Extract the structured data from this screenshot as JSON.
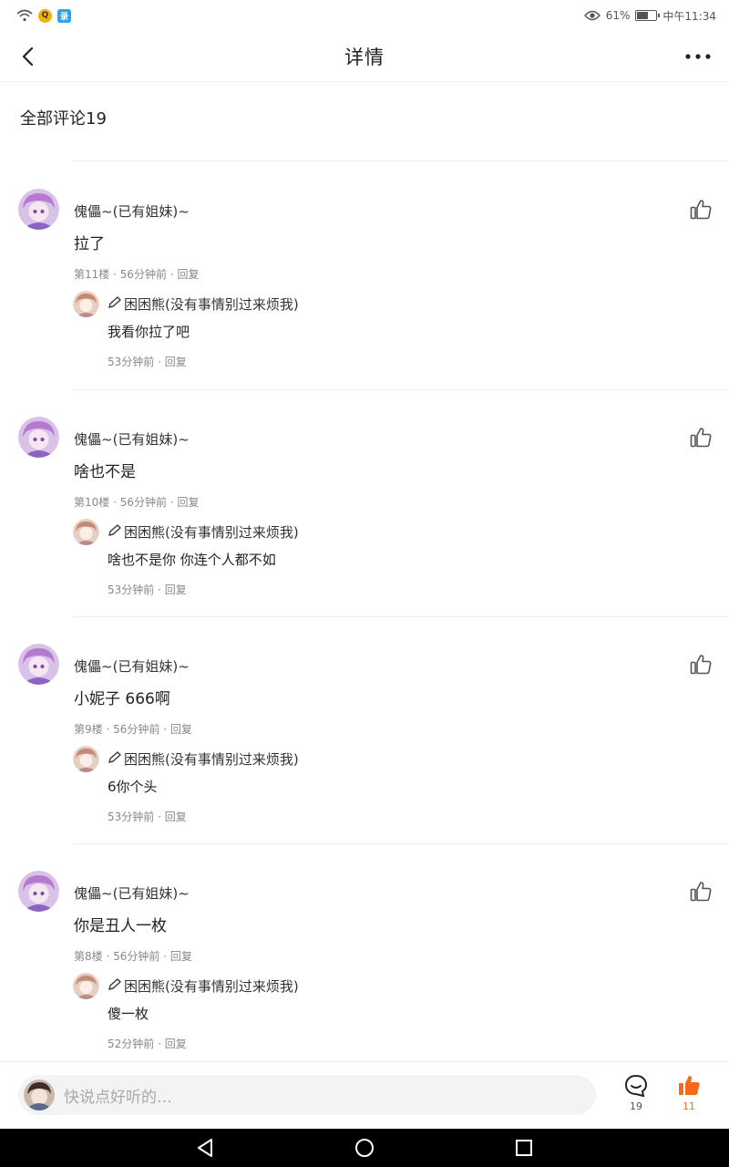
{
  "status_bar": {
    "left_icons": [
      "wifi-icon",
      "app-yellow-icon",
      "app-blue-icon"
    ],
    "yellow_badge": "Q",
    "blue_badge": "录",
    "battery_percent": "61%",
    "battery_level": 0.61,
    "time": "中午11:34"
  },
  "header": {
    "title": "详情"
  },
  "comments_header": "全部评论19",
  "comments": [
    {
      "author": "傀儡~(已有姐妹)~",
      "text": "拉了",
      "floor": "第11楼",
      "time": "56分钟前",
      "reply_label": "回复",
      "reply": {
        "author": "困困熊(没有事情别过来烦我)",
        "text": "我看你拉了吧",
        "time": "53分钟前",
        "reply_label": "回复"
      }
    },
    {
      "author": "傀儡~(已有姐妹)~",
      "text": "啥也不是",
      "floor": "第10楼",
      "time": "56分钟前",
      "reply_label": "回复",
      "reply": {
        "author": "困困熊(没有事情别过来烦我)",
        "text": "啥也不是你 你连个人都不如",
        "time": "53分钟前",
        "reply_label": "回复"
      }
    },
    {
      "author": "傀儡~(已有姐妹)~",
      "text": "小妮子 666啊",
      "floor": "第9楼",
      "time": "56分钟前",
      "reply_label": "回复",
      "reply": {
        "author": "困困熊(没有事情别过来烦我)",
        "text": "6你个头",
        "time": "53分钟前",
        "reply_label": "回复"
      }
    },
    {
      "author": "傀儡~(已有姐妹)~",
      "text": "你是丑人一枚",
      "floor": "第8楼",
      "time": "56分钟前",
      "reply_label": "回复",
      "reply": {
        "author": "困困熊(没有事情别过来烦我)",
        "text": "傻一枚",
        "time": "52分钟前",
        "reply_label": "回复"
      }
    }
  ],
  "bottom_bar": {
    "placeholder": "快说点好听的…",
    "comment_count": "19",
    "like_count": "11"
  },
  "colors": {
    "accent": "#f26b1d",
    "text": "#222222",
    "meta": "#888888"
  }
}
